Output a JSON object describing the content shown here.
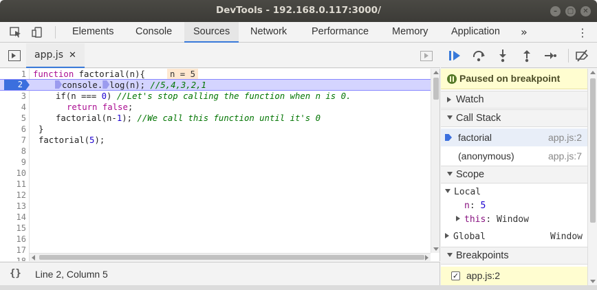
{
  "window": {
    "title": "DevTools - 192.168.0.117:3000/"
  },
  "main_tabs": [
    {
      "label": "Elements"
    },
    {
      "label": "Console"
    },
    {
      "label": "Sources",
      "active": true
    },
    {
      "label": "Network"
    },
    {
      "label": "Performance"
    },
    {
      "label": "Memory"
    },
    {
      "label": "Application"
    }
  ],
  "more_tabs_glyph": "»",
  "kebab_glyph": "⋮",
  "source_tab": {
    "filename": "app.js",
    "close_glyph": "✕"
  },
  "editor": {
    "current_line": 2,
    "inline_value": "n = 5",
    "lines": [
      {
        "n": "1"
      },
      {
        "n": "2"
      },
      {
        "n": "3"
      },
      {
        "n": "4"
      },
      {
        "n": "5"
      },
      {
        "n": "6"
      },
      {
        "n": "7"
      },
      {
        "n": "8"
      },
      {
        "n": "9"
      },
      {
        "n": "10"
      },
      {
        "n": "11"
      },
      {
        "n": "12"
      },
      {
        "n": "13"
      },
      {
        "n": "14"
      },
      {
        "n": "15"
      },
      {
        "n": "16"
      },
      {
        "n": "17"
      },
      {
        "n": "18"
      }
    ],
    "code": {
      "l1_kw": "function",
      "l1_rest": " factorial(n){",
      "l2_a": "console.",
      "l2_b": "log(n); ",
      "l2_cm": "//5,4,3,2,1",
      "l3_a": "if(n === ",
      "l3_num": "0",
      "l3_b": ") ",
      "l3_cm": "//Let's stop calling the function when n is 0.",
      "l4_kw": "return",
      "l4_b": " ",
      "l4_kw2": "false",
      "l4_c": ";",
      "l5_a": "factorial(n-",
      "l5_num": "1",
      "l5_b": "); ",
      "l5_cm": "//We call this function until it's 0",
      "l6": "}",
      "l7_a": "factorial(",
      "l7_num": "5",
      "l7_b": ");"
    }
  },
  "status": {
    "pretty_print": "{}",
    "cursor": "Line 2, Column 5"
  },
  "debugger": {
    "paused_text": "Paused on breakpoint",
    "watch_label": "Watch",
    "call_stack_label": "Call Stack",
    "call_stack": [
      {
        "fn": "factorial",
        "loc": "app.js:2",
        "selected": true
      },
      {
        "fn": "(anonymous)",
        "loc": "app.js:7"
      }
    ],
    "scope_label": "Scope",
    "local_label": "Local",
    "local_vars": {
      "n_key": "n",
      "n_sep": ": ",
      "n_val": "5",
      "this_key": "this",
      "this_sep": ": ",
      "this_val": "Window"
    },
    "global_label": "Global",
    "global_val": "Window",
    "breakpoints_label": "Breakpoints",
    "breakpoint": {
      "checked": true,
      "label": "app.js:2",
      "check_glyph": "✓"
    }
  },
  "colors": {
    "accent": "#3879d9",
    "breakpoint": "#3b6fde",
    "paused_bg": "#fffdd0",
    "current_line": "#d4d4ff"
  }
}
